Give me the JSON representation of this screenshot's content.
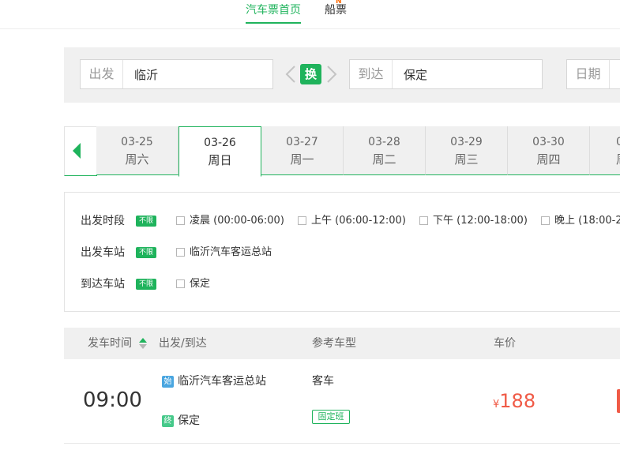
{
  "top_nav": {
    "tabs": [
      {
        "label": "汽车票首页",
        "active": true
      },
      {
        "label": "船票",
        "active": false
      }
    ],
    "new_badge": "N"
  },
  "search": {
    "from_label": "出发",
    "from_value": "临沂",
    "swap_label": "换",
    "to_label": "到达",
    "to_value": "保定",
    "date_label": "日期",
    "date_value": ""
  },
  "date_tabs": [
    {
      "md": "03-25",
      "weekday": "周六",
      "active": false
    },
    {
      "md": "03-26",
      "weekday": "周日",
      "active": true
    },
    {
      "md": "03-27",
      "weekday": "周一",
      "active": false
    },
    {
      "md": "03-28",
      "weekday": "周二",
      "active": false
    },
    {
      "md": "03-29",
      "weekday": "周三",
      "active": false
    },
    {
      "md": "03-30",
      "weekday": "周四",
      "active": false
    },
    {
      "md": "0",
      "weekday": "周",
      "active": false
    }
  ],
  "filters": {
    "unlimited": "不限",
    "departure_time": {
      "label": "出发时段",
      "options": [
        "凌晨 (00:00-06:00)",
        "上午 (06:00-12:00)",
        "下午 (12:00-18:00)",
        "晚上 (18:00-2"
      ]
    },
    "departure_station": {
      "label": "出发车站",
      "options": [
        "临沂汽车客运总站"
      ]
    },
    "arrival_station": {
      "label": "到达车站",
      "options": [
        "保定"
      ]
    }
  },
  "table": {
    "headers": {
      "time": "发车时间",
      "route": "出发/到达",
      "bus_type": "参考车型",
      "price": "车价"
    },
    "rows": [
      {
        "time": "09:00",
        "start_badge": "始",
        "start_station": "临沂汽车客运总站",
        "end_badge": "终",
        "end_station": "保定",
        "bus_type": "客车",
        "tag": "固定班",
        "currency": "¥",
        "price": "188"
      }
    ]
  },
  "colors": {
    "accent": "#1fb35c",
    "price": "#f05a46",
    "start_badge": "#4aa6e0",
    "end_badge": "#46c98a"
  }
}
